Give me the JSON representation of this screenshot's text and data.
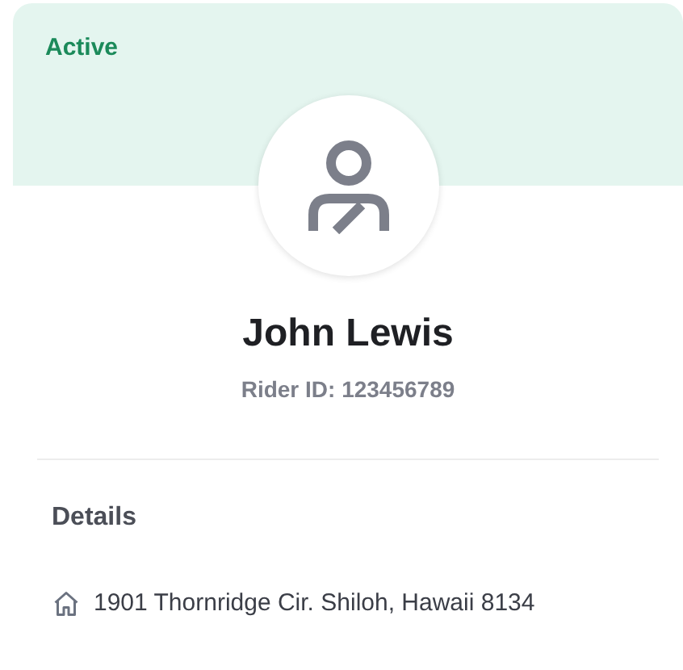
{
  "profile": {
    "status": {
      "label": "Active",
      "kind": "active"
    },
    "name": "John Lewis",
    "rider_id": "Rider ID: 123456789"
  },
  "details": {
    "title": "Details",
    "items": [
      {
        "kind": "address",
        "text": "1901 Thornridge Cir. Shiloh, Hawaii 8134"
      }
    ]
  }
}
